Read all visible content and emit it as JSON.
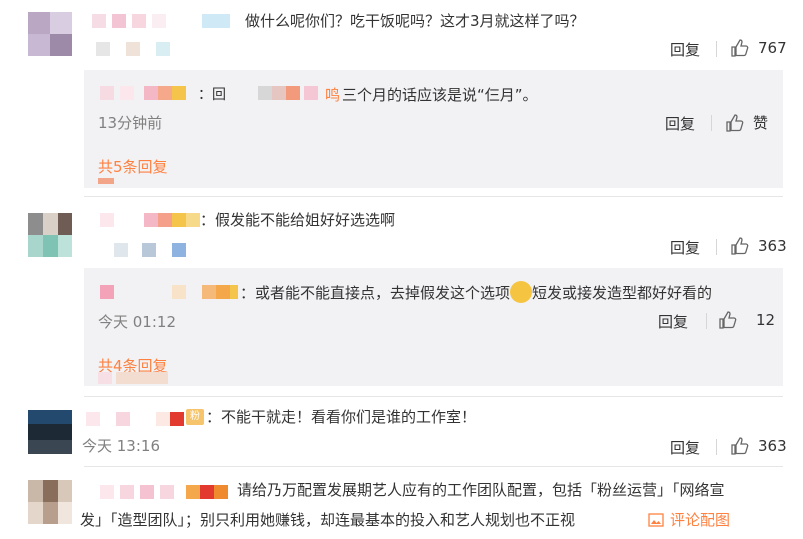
{
  "comments": [
    {
      "text": "做什么呢你们？吃干饭呢吗？这才3月就这样了吗？",
      "reply_label": "回复",
      "likes": "767",
      "reply": {
        "name_tail": "鸣",
        "prefix": "：回",
        "text": "三个月的话应该是说“仨月”。",
        "time": "13分钟前",
        "reply_label": "回复",
        "likes": "赞",
        "more": "共5条回复"
      }
    },
    {
      "text": "：假发能不能给姐好好选选啊",
      "reply_label": "回复",
      "likes": "363",
      "reply": {
        "text_before": "：或者能不能直接点，去掉假发这个选项",
        "text_after": "短发或接发造型都好好看的",
        "time": "今天 01:12",
        "reply_label": "回复",
        "likes": "12",
        "more": "共4条回复"
      }
    },
    {
      "badge": "粉",
      "text": "：不能干就走！看看你们是谁的工作室！",
      "time": "今天 13:16",
      "reply_label": "回复",
      "likes": "363"
    },
    {
      "line1": "请给乃万配置发展期艺人应有的工作团队配置，包括「粉丝运营」「网络宣",
      "line2": "发」「造型团队」；别只利用她赚钱，却连最基本的投入和艺人规划也不正视",
      "image_label": "评论配图"
    }
  ],
  "colors": {
    "accent": "#ff8140",
    "reply_bg": "#f2f2f5",
    "text": "#333333",
    "muted": "#808080"
  }
}
